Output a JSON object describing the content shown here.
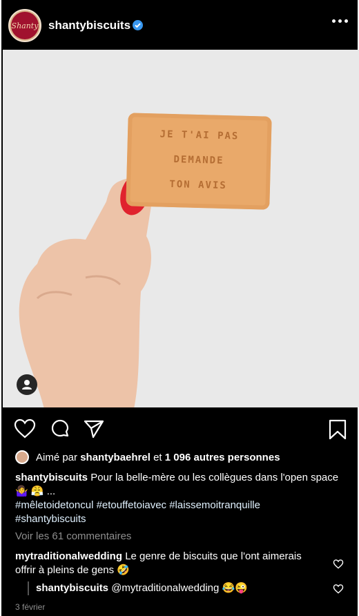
{
  "post": {
    "username": "shantybiscuits",
    "avatar_logo": "Shanty",
    "verified": true,
    "more_icon": "more-horizontal-icon"
  },
  "photo": {
    "cookie_lines": [
      "JE T'AI PAS",
      "DEMANDE",
      "TON AVIS"
    ],
    "photo_tag_icon": "user-tag-icon"
  },
  "actions": {
    "like_icon": "heart-icon",
    "comment_icon": "comment-icon",
    "share_icon": "send-icon",
    "save_icon": "bookmark-icon"
  },
  "likes": {
    "prefix": "Aimé par",
    "user": "shantybaehrel",
    "middle": "et",
    "others": "1 096 autres personnes"
  },
  "caption": {
    "user": "shantybiscuits",
    "text": "Pour la belle-mère ou les collègues dans l'open space 🤷‍♀️ 😤 ...",
    "tags_line1": "#mêletoidetoncul #etouffetoiavec #laissemoitranquille",
    "tags_line2": "#shantybiscuits"
  },
  "view_comments": "Voir les 61 commentaires",
  "comments": [
    {
      "user": "mytraditionalwedding",
      "text": "Le genre de biscuits que l'ont aimerais offrir à pleins de gens 🤣"
    },
    {
      "user": "shantybiscuits",
      "text": "@mytraditionalwedding 😂😜"
    }
  ],
  "date": "3 février",
  "colors": {
    "background": "#000000",
    "verified": "#3897f0",
    "muted": "#8e8e8e",
    "nail": "#e0232e",
    "cookie": "#e9a96a"
  }
}
